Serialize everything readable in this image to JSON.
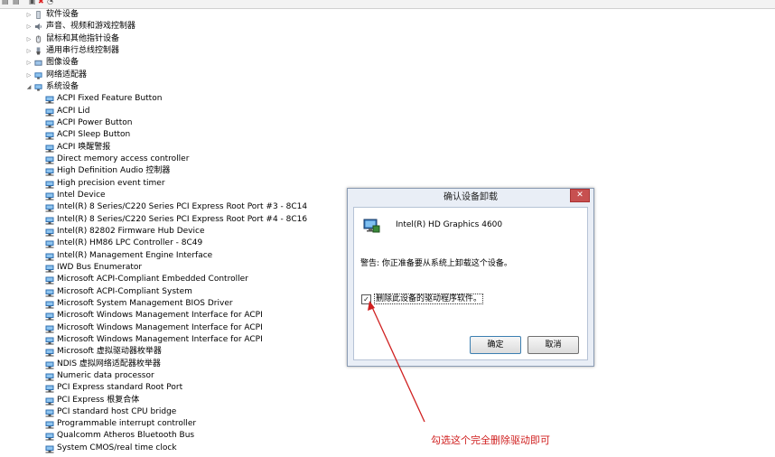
{
  "tree": {
    "categories": [
      {
        "label": "软件设备",
        "expander": "▷",
        "icon": "software-device-icon"
      },
      {
        "label": "声音、视频和游戏控制器",
        "expander": "▷",
        "icon": "sound-icon"
      },
      {
        "label": "鼠标和其他指针设备",
        "expander": "▷",
        "icon": "mouse-icon"
      },
      {
        "label": "通用串行总线控制器",
        "expander": "▷",
        "icon": "usb-icon"
      },
      {
        "label": "图像设备",
        "expander": "▷",
        "icon": "camera-icon"
      },
      {
        "label": "网络适配器",
        "expander": "▷",
        "icon": "network-icon"
      },
      {
        "label": "系统设备",
        "expander": "◢",
        "icon": "system-folder-icon"
      }
    ],
    "system_devices": [
      "ACPI Fixed Feature Button",
      "ACPI Lid",
      "ACPI Power Button",
      "ACPI Sleep Button",
      "ACPI 唤醒警报",
      "Direct memory access controller",
      "High Definition Audio 控制器",
      "High precision event timer",
      "Intel Device",
      "Intel(R) 8 Series/C220 Series PCI Express Root Port #3 - 8C14",
      "Intel(R) 8 Series/C220 Series PCI Express Root Port #4 - 8C16",
      "Intel(R) 82802 Firmware Hub Device",
      "Intel(R) HM86 LPC Controller - 8C49",
      "Intel(R) Management Engine Interface",
      "IWD Bus Enumerator",
      "Microsoft ACPI-Compliant Embedded Controller",
      "Microsoft ACPI-Compliant System",
      "Microsoft System Management BIOS Driver",
      "Microsoft Windows Management Interface for ACPI",
      "Microsoft Windows Management Interface for ACPI",
      "Microsoft Windows Management Interface for ACPI",
      "Microsoft 虚拟驱动器枚举器",
      "NDIS 虚拟网络适配器枚举器",
      "Numeric data processor",
      "PCI Express standard Root Port",
      "PCI Express 根复合体",
      "PCI standard host CPU bridge",
      "Programmable interrupt controller",
      "Qualcomm Atheros Bluetooth Bus",
      "System CMOS/real time clock"
    ]
  },
  "dialog": {
    "title": "确认设备卸载",
    "close_glyph": "✕",
    "device_name": "Intel(R) HD Graphics 4600",
    "warning": "警告: 你正准备要从系统上卸载这个设备。",
    "checkbox_checked": true,
    "checkbox_glyph": "✓",
    "checkbox_label": "删除此设备的驱动程序软件。",
    "ok_label": "确定",
    "cancel_label": "取消"
  },
  "annotation": {
    "text": "勾选这个完全删除驱动即可",
    "color": "#d02020"
  }
}
